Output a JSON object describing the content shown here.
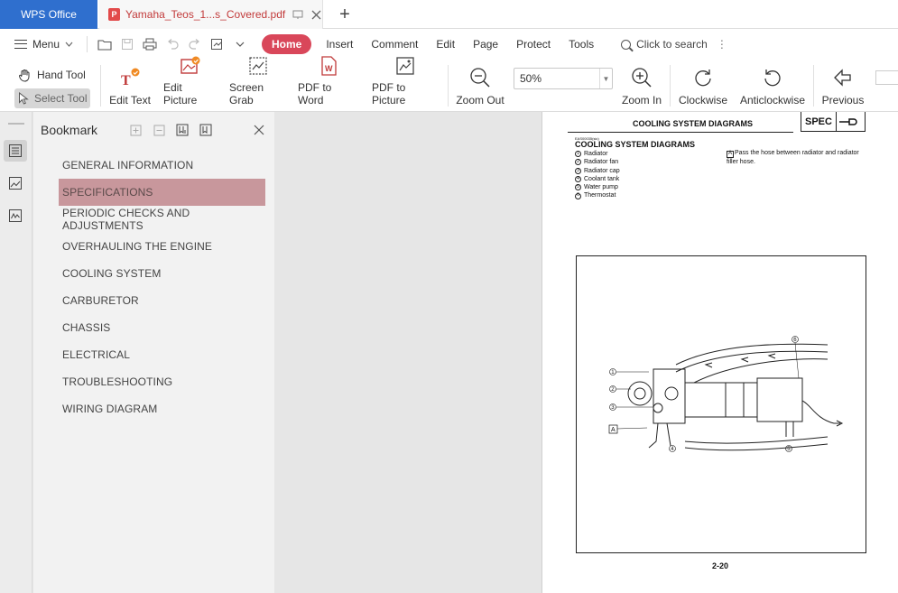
{
  "titlebar": {
    "app_name": "WPS Office",
    "doc_tab_title": "Yamaha_Teos_1...s_Covered.pdf",
    "new_tab": "+"
  },
  "menu": {
    "menu_label": "Menu",
    "home": "Home",
    "items": [
      "Insert",
      "Comment",
      "Edit",
      "Page",
      "Protect",
      "Tools"
    ],
    "search_label": "Click to search"
  },
  "toolbar": {
    "hand_tool": "Hand Tool",
    "select_tool": "Select Tool",
    "edit_text": "Edit Text",
    "edit_picture": "Edit Picture",
    "screen_grab": "Screen Grab",
    "pdf_to_word": "PDF to Word",
    "pdf_to_picture": "PDF to Picture",
    "zoom_out": "Zoom Out",
    "zoom_value": "50%",
    "zoom_in": "Zoom In",
    "clockwise": "Clockwise",
    "anticlockwise": "Anticlockwise",
    "previous": "Previous"
  },
  "bookmark": {
    "title": "Bookmark",
    "items": [
      "GENERAL INFORMATION",
      "SPECIFICATIONS",
      "PERIODIC CHECKS AND ADJUSTMENTS",
      "OVERHAULING THE ENGINE",
      "COOLING SYSTEM",
      "CARBURETOR",
      "CHASSIS",
      "ELECTRICAL",
      "TROUBLESHOOTING",
      "WIRING DIAGRAM"
    ],
    "selected_index": 1
  },
  "document_page": {
    "section_title": "COOLING SYSTEM DIAGRAMS",
    "spec_badge": "SPEC",
    "code": "EAS00035(sic)",
    "heading": "COOLING SYSTEM DIAGRAMS",
    "legend": [
      {
        "n": "1",
        "label": "Radiator"
      },
      {
        "n": "2",
        "label": "Radiator fan"
      },
      {
        "n": "3",
        "label": "Radiator cap"
      },
      {
        "n": "4",
        "label": "Coolant tank"
      },
      {
        "n": "5",
        "label": "Water pump"
      },
      {
        "n": "6",
        "label": "Thermostat"
      }
    ],
    "note_marker": "A",
    "note": "Pass the hose between radiator and radiator filler hose.",
    "figure_marker": "A",
    "page_number": "2-20"
  },
  "colors": {
    "app_tab": "#2f6fce",
    "home_pill": "#d9475a",
    "bookmark_selected": "#c8979c"
  }
}
